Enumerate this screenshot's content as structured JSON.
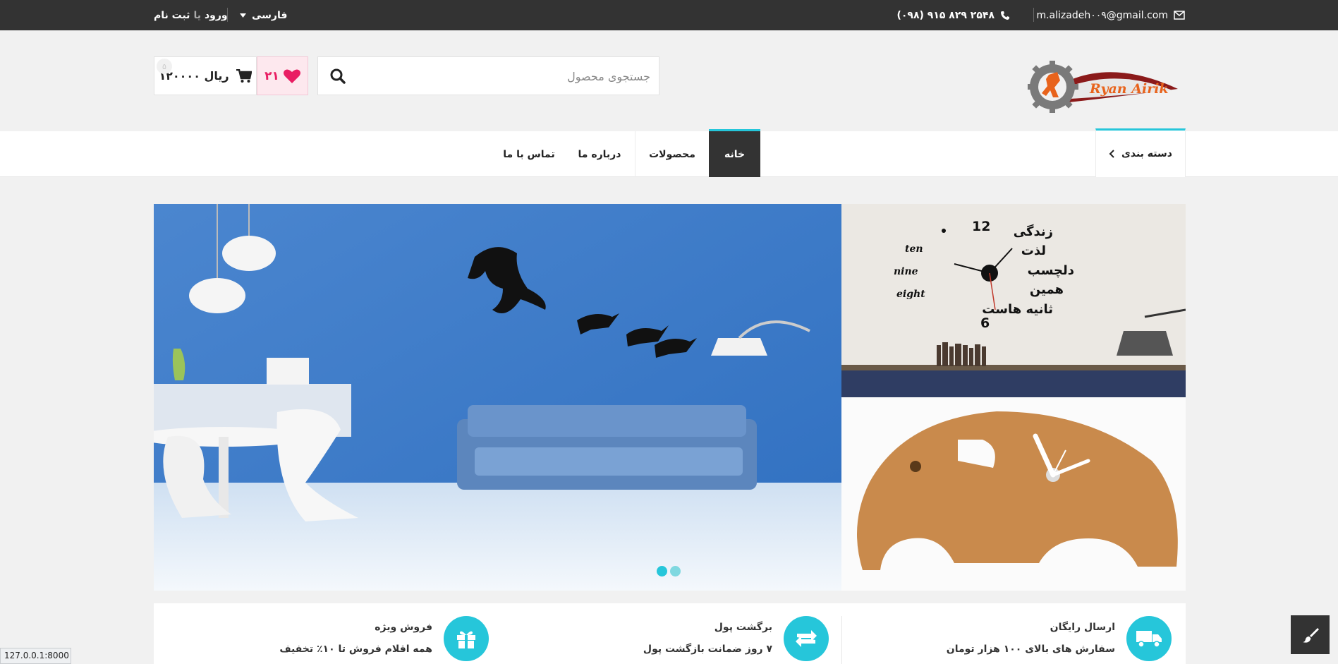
{
  "topbar": {
    "email": "m.alizadeh۰۰۹@gmail.com",
    "phone": "(۰۹۸) ۹۱۵ ۸۲۹ ۲۵۴۸",
    "language": "فارسی",
    "login": "ورود",
    "or": "یا",
    "register": "ثبت نام"
  },
  "header": {
    "logo_text": "Ryan Airik",
    "search_placeholder": "جستجوی محصول",
    "wishlist_count": "۲۱",
    "cart_total": "۱۲۰۰۰۰ ریال",
    "cart_badge": "۵"
  },
  "nav": {
    "category": "دسته بندی",
    "items": [
      {
        "label": "خانه",
        "active": true
      },
      {
        "label": "محصولات",
        "active": false
      },
      {
        "label": "درباره ما",
        "active": false
      },
      {
        "label": "تماس با ما",
        "active": false
      }
    ]
  },
  "banners": {
    "clock_numbers": [
      "12",
      "6"
    ],
    "clock_words": [
      "ten",
      "nine",
      "eight"
    ],
    "clock_persian": [
      "زندگی",
      "لذت",
      "دلچسب",
      "همین",
      "ثانیه هاست"
    ]
  },
  "features": [
    {
      "title": "ارسال رایگان",
      "desc": "سفارش های بالای ۱۰۰ هزار تومان",
      "icon": "truck-icon"
    },
    {
      "title": "برگشت پول",
      "desc": "۷ روز ضمانت بازگشت پول",
      "icon": "refresh-icon"
    },
    {
      "title": "فروش ویژه",
      "desc": "همه اقلام فروش تا ۱۰٪ تخفیف",
      "icon": "gift-icon"
    }
  ],
  "status_url": "127.0.0.1:8000",
  "colors": {
    "accent": "#26c6da",
    "dark": "#333333",
    "pink": "#e91e63"
  }
}
